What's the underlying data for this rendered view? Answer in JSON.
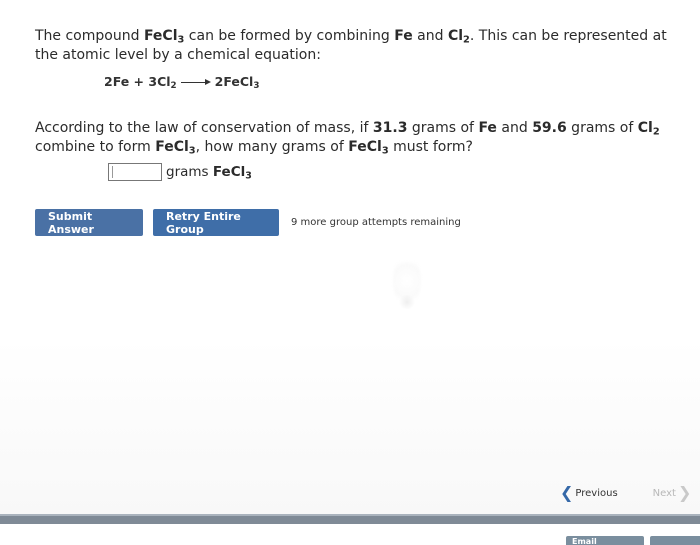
{
  "problem": {
    "intro_p1": "The compound ",
    "compound_base": "FeCl",
    "compound_sub": "3",
    "intro_p2": " can be formed by combining ",
    "reactant1": "Fe",
    "intro_p3": " and ",
    "reactant2_base": "Cl",
    "reactant2_sub": "2",
    "intro_p4": ". This can be represented at the atomic level by a chemical equation:",
    "equation": {
      "left_a": "2Fe + 3Cl",
      "left_sub": "2",
      "right_base": "2FeCl",
      "right_sub": "3"
    },
    "question_p1": "According to the law of conservation of mass, if ",
    "mass_fe": "31.3",
    "question_p2": " grams of ",
    "question_fe": "Fe",
    "question_p3": " and ",
    "mass_cl2": "59.6",
    "question_p4": " grams of ",
    "question_cl_base": "Cl",
    "question_cl_sub": "2",
    "question_p5": " combine to form ",
    "question_product_base": "FeCl",
    "question_product_sub": "3",
    "question_p6": ", how many grams of ",
    "question_product2_base": "FeCl",
    "question_product2_sub": "3",
    "question_p7": " must form?",
    "answer": {
      "value": "",
      "unit_prefix": "grams ",
      "unit_base": "FeCl",
      "unit_sub": "3"
    }
  },
  "actions": {
    "submit_label": "Submit Answer",
    "retry_label": "Retry Entire Group",
    "attempts_text": "9 more group attempts remaining"
  },
  "nav": {
    "previous_label": "Previous",
    "next_label": "Next"
  },
  "footer": {
    "email_label": "Email Instructor"
  },
  "colors": {
    "button_blue": "#4a71a5",
    "footer_bar": "#7f8a96"
  }
}
